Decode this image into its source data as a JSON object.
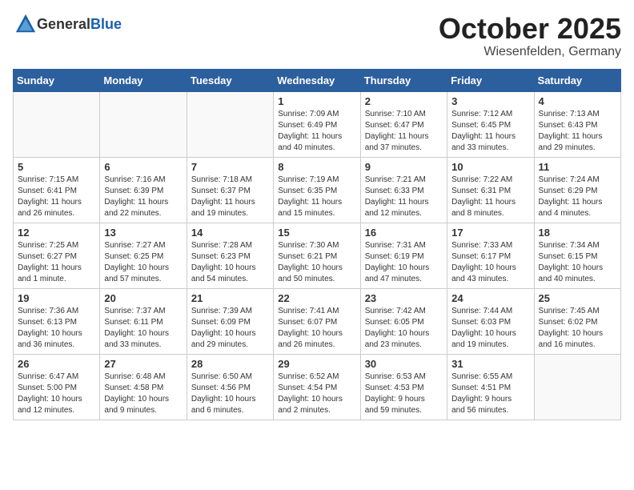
{
  "header": {
    "logo_general": "General",
    "logo_blue": "Blue",
    "month_title": "October 2025",
    "location": "Wiesenfelden, Germany"
  },
  "weekdays": [
    "Sunday",
    "Monday",
    "Tuesday",
    "Wednesday",
    "Thursday",
    "Friday",
    "Saturday"
  ],
  "weeks": [
    [
      {
        "day": "",
        "info": ""
      },
      {
        "day": "",
        "info": ""
      },
      {
        "day": "",
        "info": ""
      },
      {
        "day": "1",
        "info": "Sunrise: 7:09 AM\nSunset: 6:49 PM\nDaylight: 11 hours\nand 40 minutes."
      },
      {
        "day": "2",
        "info": "Sunrise: 7:10 AM\nSunset: 6:47 PM\nDaylight: 11 hours\nand 37 minutes."
      },
      {
        "day": "3",
        "info": "Sunrise: 7:12 AM\nSunset: 6:45 PM\nDaylight: 11 hours\nand 33 minutes."
      },
      {
        "day": "4",
        "info": "Sunrise: 7:13 AM\nSunset: 6:43 PM\nDaylight: 11 hours\nand 29 minutes."
      }
    ],
    [
      {
        "day": "5",
        "info": "Sunrise: 7:15 AM\nSunset: 6:41 PM\nDaylight: 11 hours\nand 26 minutes."
      },
      {
        "day": "6",
        "info": "Sunrise: 7:16 AM\nSunset: 6:39 PM\nDaylight: 11 hours\nand 22 minutes."
      },
      {
        "day": "7",
        "info": "Sunrise: 7:18 AM\nSunset: 6:37 PM\nDaylight: 11 hours\nand 19 minutes."
      },
      {
        "day": "8",
        "info": "Sunrise: 7:19 AM\nSunset: 6:35 PM\nDaylight: 11 hours\nand 15 minutes."
      },
      {
        "day": "9",
        "info": "Sunrise: 7:21 AM\nSunset: 6:33 PM\nDaylight: 11 hours\nand 12 minutes."
      },
      {
        "day": "10",
        "info": "Sunrise: 7:22 AM\nSunset: 6:31 PM\nDaylight: 11 hours\nand 8 minutes."
      },
      {
        "day": "11",
        "info": "Sunrise: 7:24 AM\nSunset: 6:29 PM\nDaylight: 11 hours\nand 4 minutes."
      }
    ],
    [
      {
        "day": "12",
        "info": "Sunrise: 7:25 AM\nSunset: 6:27 PM\nDaylight: 11 hours\nand 1 minute."
      },
      {
        "day": "13",
        "info": "Sunrise: 7:27 AM\nSunset: 6:25 PM\nDaylight: 10 hours\nand 57 minutes."
      },
      {
        "day": "14",
        "info": "Sunrise: 7:28 AM\nSunset: 6:23 PM\nDaylight: 10 hours\nand 54 minutes."
      },
      {
        "day": "15",
        "info": "Sunrise: 7:30 AM\nSunset: 6:21 PM\nDaylight: 10 hours\nand 50 minutes."
      },
      {
        "day": "16",
        "info": "Sunrise: 7:31 AM\nSunset: 6:19 PM\nDaylight: 10 hours\nand 47 minutes."
      },
      {
        "day": "17",
        "info": "Sunrise: 7:33 AM\nSunset: 6:17 PM\nDaylight: 10 hours\nand 43 minutes."
      },
      {
        "day": "18",
        "info": "Sunrise: 7:34 AM\nSunset: 6:15 PM\nDaylight: 10 hours\nand 40 minutes."
      }
    ],
    [
      {
        "day": "19",
        "info": "Sunrise: 7:36 AM\nSunset: 6:13 PM\nDaylight: 10 hours\nand 36 minutes."
      },
      {
        "day": "20",
        "info": "Sunrise: 7:37 AM\nSunset: 6:11 PM\nDaylight: 10 hours\nand 33 minutes."
      },
      {
        "day": "21",
        "info": "Sunrise: 7:39 AM\nSunset: 6:09 PM\nDaylight: 10 hours\nand 29 minutes."
      },
      {
        "day": "22",
        "info": "Sunrise: 7:41 AM\nSunset: 6:07 PM\nDaylight: 10 hours\nand 26 minutes."
      },
      {
        "day": "23",
        "info": "Sunrise: 7:42 AM\nSunset: 6:05 PM\nDaylight: 10 hours\nand 23 minutes."
      },
      {
        "day": "24",
        "info": "Sunrise: 7:44 AM\nSunset: 6:03 PM\nDaylight: 10 hours\nand 19 minutes."
      },
      {
        "day": "25",
        "info": "Sunrise: 7:45 AM\nSunset: 6:02 PM\nDaylight: 10 hours\nand 16 minutes."
      }
    ],
    [
      {
        "day": "26",
        "info": "Sunrise: 6:47 AM\nSunset: 5:00 PM\nDaylight: 10 hours\nand 12 minutes."
      },
      {
        "day": "27",
        "info": "Sunrise: 6:48 AM\nSunset: 4:58 PM\nDaylight: 10 hours\nand 9 minutes."
      },
      {
        "day": "28",
        "info": "Sunrise: 6:50 AM\nSunset: 4:56 PM\nDaylight: 10 hours\nand 6 minutes."
      },
      {
        "day": "29",
        "info": "Sunrise: 6:52 AM\nSunset: 4:54 PM\nDaylight: 10 hours\nand 2 minutes."
      },
      {
        "day": "30",
        "info": "Sunrise: 6:53 AM\nSunset: 4:53 PM\nDaylight: 9 hours\nand 59 minutes."
      },
      {
        "day": "31",
        "info": "Sunrise: 6:55 AM\nSunset: 4:51 PM\nDaylight: 9 hours\nand 56 minutes."
      },
      {
        "day": "",
        "info": ""
      }
    ]
  ]
}
